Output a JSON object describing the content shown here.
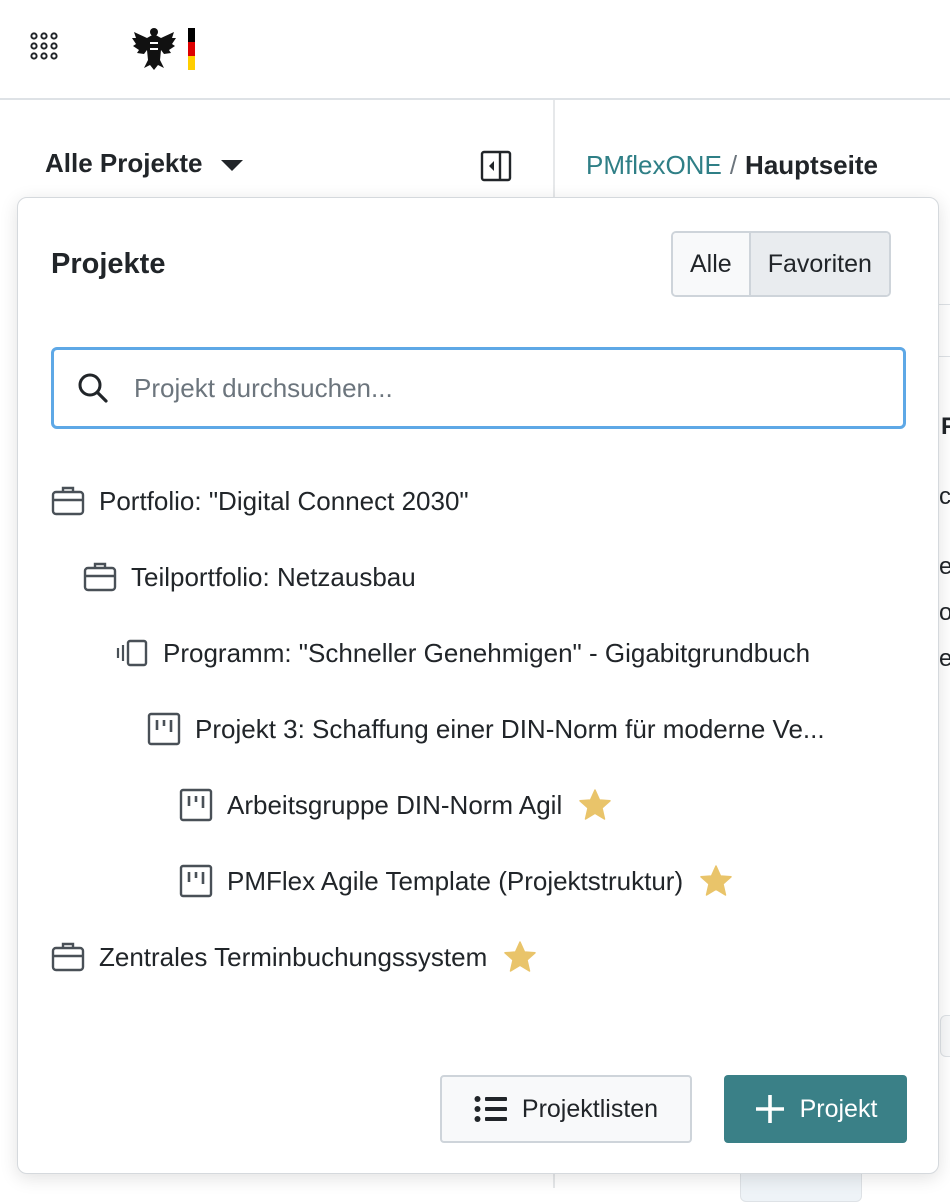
{
  "header": {
    "project_select_label": "Alle Projekte"
  },
  "breadcrumb": {
    "root": "PMflexONE",
    "separator": "/",
    "current": "Hauptseite"
  },
  "background_fragments": {
    "row1": "F",
    "row2": "cl",
    "row3": "eg",
    "row4": "o",
    "row5": "e"
  },
  "dropdown": {
    "title": "Projekte",
    "filter": {
      "options": [
        "Alle",
        "Favoriten"
      ],
      "selected": "Favoriten"
    },
    "search": {
      "placeholder": "Projekt durchsuchen...",
      "value": ""
    },
    "tree": [
      {
        "type": "portfolio",
        "icon": "briefcase-icon",
        "label": "Portfolio: \"Digital Connect 2030\"",
        "level": 0,
        "favorite": false
      },
      {
        "type": "subportfolio",
        "icon": "briefcase-icon",
        "label": "Teilportfolio: Netzausbau",
        "level": 1,
        "favorite": false
      },
      {
        "type": "program",
        "icon": "program-stack-icon",
        "label": "Programm: \"Schneller Genehmigen\" - Gigabitgrundbuch",
        "level": 2,
        "favorite": false
      },
      {
        "type": "project",
        "icon": "kanban-board-icon",
        "label": "Projekt 3: Schaffung einer DIN-Norm für moderne Ve...",
        "level": 3,
        "favorite": false
      },
      {
        "type": "project",
        "icon": "kanban-board-icon",
        "label": "Arbeitsgruppe DIN-Norm Agil",
        "level": 4,
        "favorite": true
      },
      {
        "type": "project",
        "icon": "kanban-board-icon",
        "label": "PMFlex Agile Template (Projektstruktur)",
        "level": 4,
        "favorite": true
      },
      {
        "type": "portfolio",
        "icon": "briefcase-icon",
        "label": "Zentrales Terminbuchungssystem",
        "level": 0,
        "favorite": true
      }
    ],
    "buttons": {
      "lists_label": "Projektlisten",
      "new_label": "Projekt"
    }
  },
  "colors": {
    "accent": "#3a8087",
    "link": "#2f7f86",
    "star": "#e9c46a",
    "focus": "#5ea8e6"
  }
}
